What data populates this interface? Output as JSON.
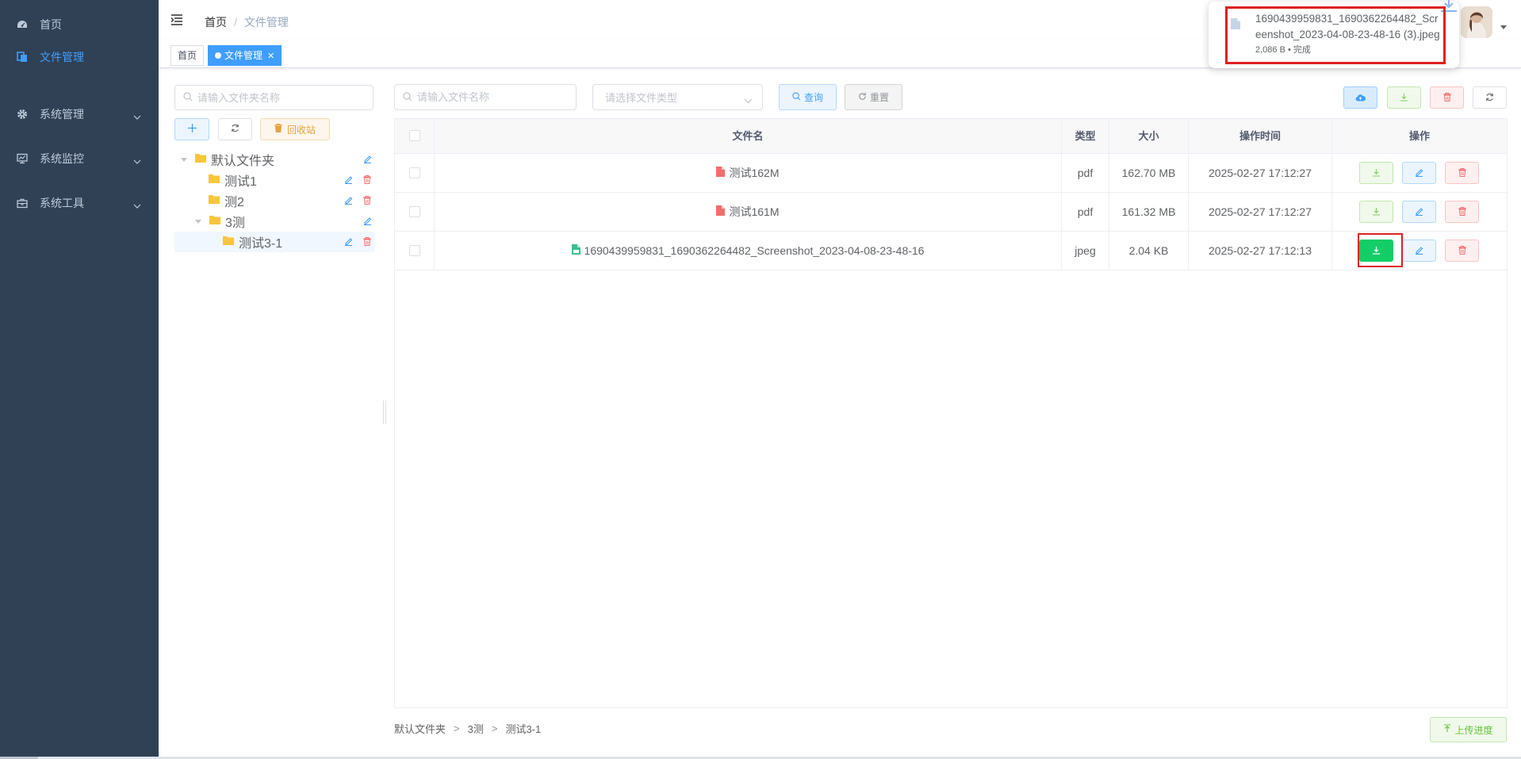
{
  "sidebar": {
    "items": [
      {
        "label": "首页",
        "icon": "dashboard-icon"
      },
      {
        "label": "文件管理",
        "icon": "files-icon",
        "active": true
      },
      {
        "label": "系统管理",
        "icon": "gear-icon",
        "has_children": true
      },
      {
        "label": "系统监控",
        "icon": "monitor-icon",
        "has_children": true
      },
      {
        "label": "系统工具",
        "icon": "toolbox-icon",
        "has_children": true
      }
    ]
  },
  "navbar": {
    "breadcrumb": [
      "首页",
      "文件管理"
    ]
  },
  "tags": [
    {
      "label": "首页",
      "active": false
    },
    {
      "label": "文件管理",
      "active": true
    }
  ],
  "download_popup": {
    "filename": "1690439959831_1690362264482_Screenshot_2023-04-08-23-48-16 (3).jpeg",
    "meta": "2,086 B • 完成"
  },
  "folder_panel": {
    "search_placeholder": "请输入文件夹名称",
    "recycle_label": "回收站",
    "tree": [
      {
        "label": "默认文件夹",
        "level": 0,
        "expanded": true
      },
      {
        "label": "测试1",
        "level": 1
      },
      {
        "label": "测2",
        "level": 1
      },
      {
        "label": "3测",
        "level": 1,
        "expanded": true
      },
      {
        "label": "测试3-1",
        "level": 2,
        "selected": true
      }
    ]
  },
  "file_panel": {
    "search_placeholder": "请输入文件名称",
    "type_placeholder": "请选择文件类型",
    "query_label": "查询",
    "reset_label": "重置",
    "columns": [
      "文件名",
      "类型",
      "大小",
      "操作时间",
      "操作"
    ],
    "rows": [
      {
        "name": "测试162M",
        "type": "pdf",
        "size": "162.70 MB",
        "time": "2025-02-27 17:12:27",
        "icon": "pdf-file-icon"
      },
      {
        "name": "测试161M",
        "type": "pdf",
        "size": "161.32 MB",
        "time": "2025-02-27 17:12:27",
        "icon": "pdf-file-icon"
      },
      {
        "name": "1690439959831_1690362264482_Screenshot_2023-04-08-23-48-16",
        "type": "jpeg",
        "size": "2.04 KB",
        "time": "2025-02-27 17:12:13",
        "icon": "image-file-icon"
      }
    ],
    "path": [
      "默认文件夹",
      "3测",
      "测试3-1"
    ],
    "path_sep": ">",
    "progress_label": "上传进度"
  },
  "colors": {
    "sidebar_bg": "#304156",
    "primary": "#409eff",
    "success": "#13ce66",
    "danger": "#f56c6c",
    "warning": "#e6a23c",
    "highlight": "#e02020"
  }
}
